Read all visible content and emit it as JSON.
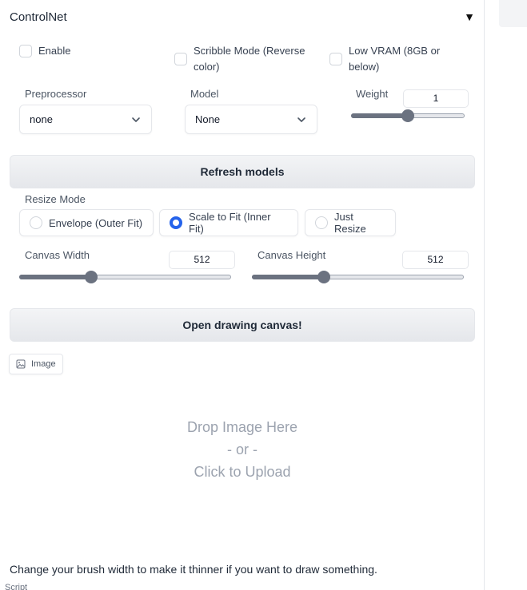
{
  "panel": {
    "title": "ControlNet",
    "toggle_icon": "▼"
  },
  "options": {
    "enable": {
      "label": "Enable",
      "checked": false
    },
    "scribble": {
      "label_line1": "Scribble Mode (Reverse",
      "label_line2": "color)",
      "checked": false
    },
    "lowvram": {
      "label_line1": "Low VRAM (8GB or",
      "label_line2": "below)",
      "checked": false
    }
  },
  "preprocessor": {
    "label": "Preprocessor",
    "value": "none"
  },
  "model": {
    "label": "Model",
    "value": "None"
  },
  "weight": {
    "label": "Weight",
    "value": "1",
    "level": 0.5
  },
  "refresh_label": "Refresh models",
  "resize": {
    "label": "Resize Mode",
    "options": [
      "Envelope (Outer Fit)",
      "Scale to Fit (Inner Fit)",
      "Just Resize"
    ],
    "selected": "Scale to Fit (Inner Fit)"
  },
  "canvas_width": {
    "label": "Canvas Width",
    "value": "512",
    "level": 0.34
  },
  "canvas_height": {
    "label": "Canvas Height",
    "value": "512",
    "level": 0.34
  },
  "open_canvas_label": "Open drawing canvas!",
  "image_tab": {
    "label": "Image",
    "icon": "image-icon"
  },
  "dropzone": {
    "line1": "Drop Image Here",
    "line2": "- or -",
    "line3": "Click to Upload"
  },
  "hint": "Change your brush width to make it thinner if you want to draw something.",
  "script_label": "Script",
  "colors": {
    "accent": "#2563eb",
    "slider": "#6b7280",
    "border": "#e5e7eb"
  }
}
